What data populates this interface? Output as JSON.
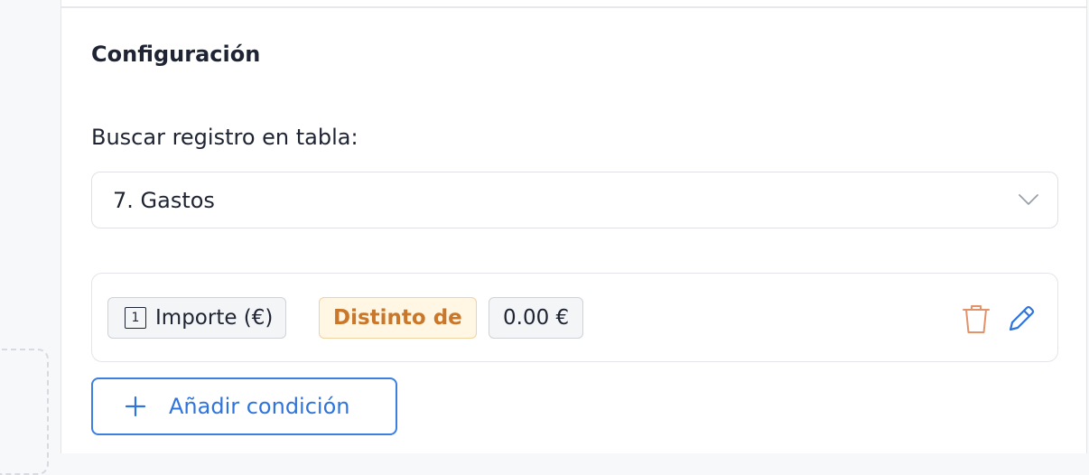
{
  "config": {
    "title": "Configuración",
    "table_label": "Buscar registro en tabla:",
    "table_selected": "7. Gastos"
  },
  "condition": {
    "field_number": "1",
    "field_name": "Importe (€)",
    "operator": "Distinto de",
    "value": "0.00 €"
  },
  "actions": {
    "add_condition_label": "Añadir condición"
  },
  "icons": {
    "select": "chevron-down-icon",
    "delete": "trash-icon",
    "edit": "pencil-icon",
    "add": "plus-icon"
  },
  "colors": {
    "accent": "#2f74dc",
    "operator_text": "#c9772a",
    "operator_bg": "#fff6e3",
    "delete_icon": "#e3926a"
  }
}
